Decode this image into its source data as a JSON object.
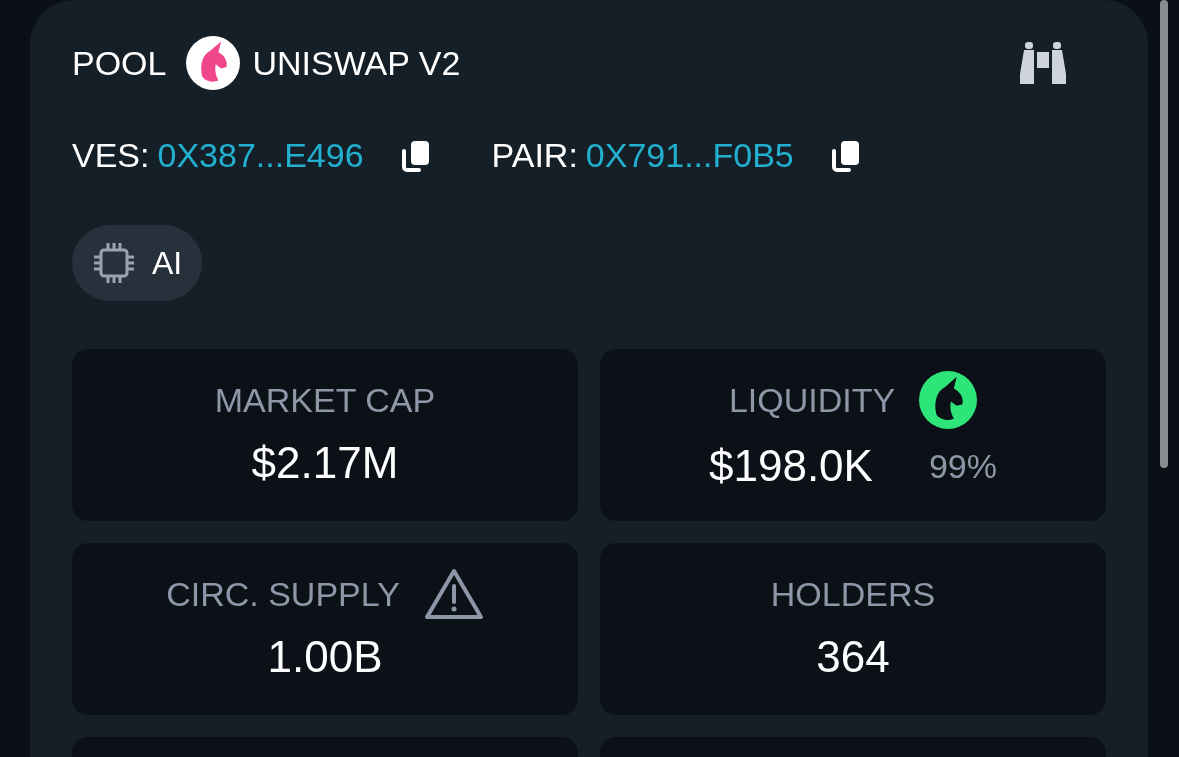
{
  "header": {
    "label": "POOL",
    "dex": "UNISWAP V2"
  },
  "addresses": [
    {
      "label": "VES:",
      "value": "0X387...E496"
    },
    {
      "label": "PAIR:",
      "value": "0X791...F0B5"
    }
  ],
  "tags": [
    {
      "label": "AI"
    }
  ],
  "stats": [
    {
      "kind": "stat",
      "label": "MARKET CAP",
      "value": "$2.17M",
      "warning": false
    },
    {
      "kind": "stat",
      "label": "LIQUIDITY",
      "value": "$198.0K",
      "warning": false,
      "badge_percent": "99%"
    },
    {
      "kind": "stat",
      "label": "CIRC. SUPPLY",
      "value": "1.00B",
      "warning": true
    },
    {
      "kind": "stat",
      "label": "HOLDERS",
      "value": "364",
      "warning": false
    },
    {
      "kind": "empty"
    },
    {
      "kind": "empty"
    }
  ]
}
